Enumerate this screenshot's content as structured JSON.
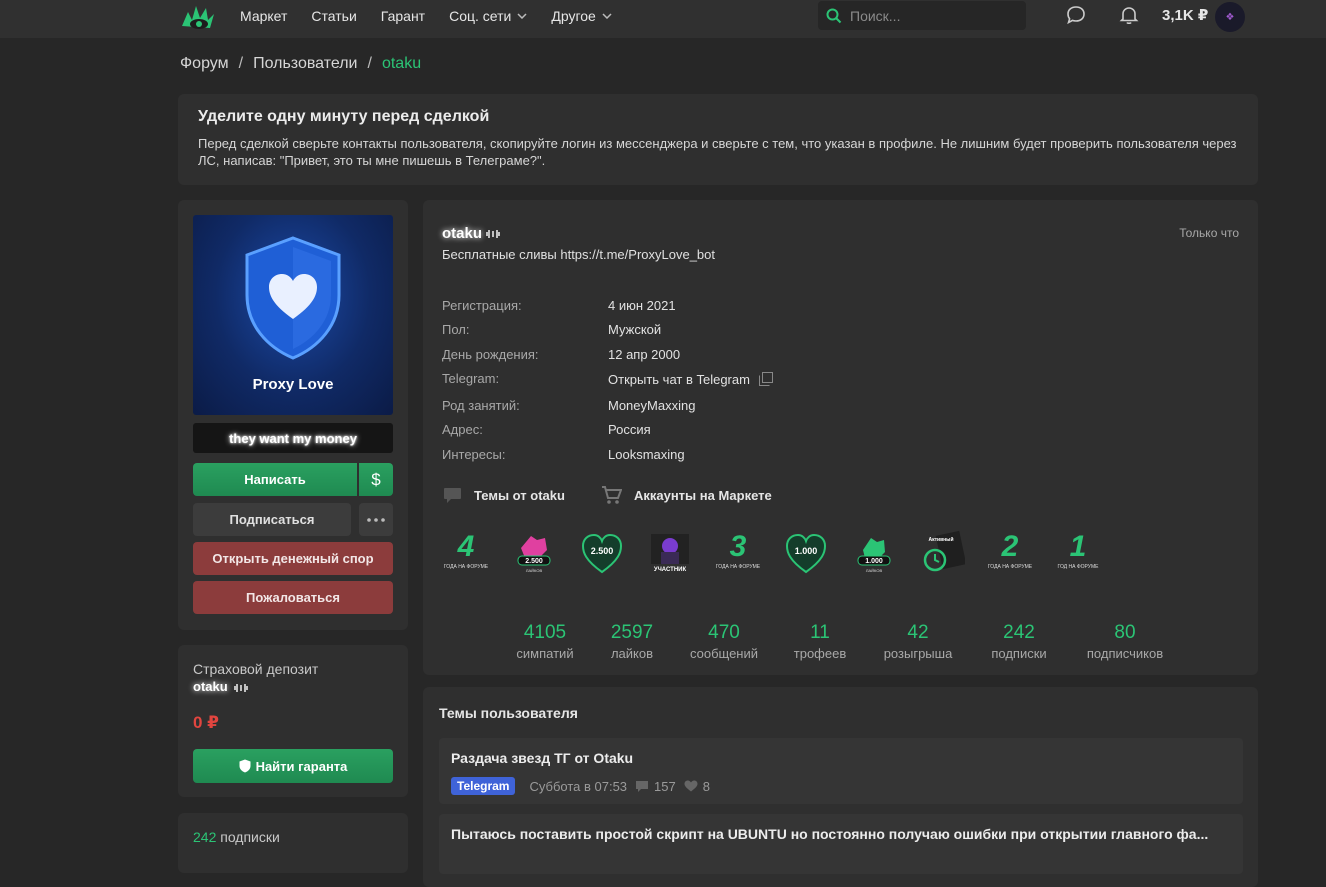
{
  "topbar": {
    "nav": [
      {
        "label": "Маркет",
        "dropdown": false
      },
      {
        "label": "Статьи",
        "dropdown": false
      },
      {
        "label": "Гарант",
        "dropdown": false
      },
      {
        "label": "Соц. сети",
        "dropdown": true
      },
      {
        "label": "Другое",
        "dropdown": true
      }
    ],
    "search_placeholder": "Поиск...",
    "balance": "3,1K ₽"
  },
  "breadcrumb": {
    "items": [
      "Форум",
      "Пользователи"
    ],
    "current": "otaku"
  },
  "notice": {
    "title": "Уделите одну минуту перед сделкой",
    "text": "Перед сделкой сверьте контакты пользователя, скопируйте логин из мессенджера и сверьте с тем, что указан в профиле. Не лишним будет проверить пользователя через ЛС, написав: \"Привет, это ты мне пишешь в Телеграме?\"."
  },
  "sidebar": {
    "avatar_caption": "Proxy Love",
    "user_title": "they want my money",
    "write_button": "Написать",
    "dollar_button": "$",
    "subscribe_button": "Подписаться",
    "dispute_button": "Открыть денежный спор",
    "report_button": "Пожаловаться",
    "deposit_label": "Страховой депозит",
    "deposit_user": "otaku",
    "deposit_amount": "0 ₽",
    "guarantor_button": "Найти гаранта",
    "subs_count": "242",
    "subs_label": "подписки"
  },
  "profile": {
    "username": "otaku",
    "status": "Бесплатные сливы https://t.me/ProxyLove_bot",
    "last_seen": "Только что",
    "info": [
      {
        "key": "Регистрация:",
        "value": "4 июн 2021"
      },
      {
        "key": "Пол:",
        "value": "Мужской"
      },
      {
        "key": "День рождения:",
        "value": "12 апр 2000"
      },
      {
        "key": "Telegram:",
        "value": "Открыть чат в Telegram"
      },
      {
        "key": "Род занятий:",
        "value": "MoneyMaxxing"
      },
      {
        "key": "Адрес:",
        "value": "Россия"
      },
      {
        "key": "Интересы:",
        "value": "Looksmaxing"
      }
    ],
    "links": [
      "Темы от otaku",
      "Аккаунты на Маркете"
    ],
    "trophies": [
      {
        "icon": "years-4-trophy-icon",
        "big": "4",
        "small": "ГОДА НА ФОРУМЕ"
      },
      {
        "icon": "likes-2500-trophy-icon",
        "big": "2.500",
        "small": "ЛАЙКОВ"
      },
      {
        "icon": "sympathies-2500-trophy-icon",
        "big": "2.500",
        "small": ""
      },
      {
        "icon": "participant-trophy-icon",
        "big": "",
        "small": "УЧАСТНИК"
      },
      {
        "icon": "years-3-trophy-icon",
        "big": "3",
        "small": "ГОДА НА ФОРУМЕ"
      },
      {
        "icon": "sympathies-1000-trophy-icon",
        "big": "1.000",
        "small": ""
      },
      {
        "icon": "likes-1000-trophy-icon",
        "big": "1.000",
        "small": "ЛАЙКОВ"
      },
      {
        "icon": "active-trophy-icon",
        "big": "",
        "small": "Активный"
      },
      {
        "icon": "years-2-trophy-icon",
        "big": "2",
        "small": "ГОДА НА ФОРУМЕ"
      },
      {
        "icon": "years-1-trophy-icon",
        "big": "1",
        "small": "ГОД НА ФОРУМЕ"
      }
    ],
    "stats": [
      {
        "num": "4105",
        "label": "симпатий"
      },
      {
        "num": "2597",
        "label": "лайков"
      },
      {
        "num": "470",
        "label": "сообщений"
      },
      {
        "num": "11",
        "label": "трофеев"
      },
      {
        "num": "42",
        "label": "розыгрыша"
      },
      {
        "num": "242",
        "label": "подписки"
      },
      {
        "num": "80",
        "label": "подписчиков"
      }
    ]
  },
  "topics": {
    "title": "Темы пользователя",
    "items": [
      {
        "title": "Раздача звезд ТГ от Otaku",
        "tag": "Telegram",
        "date": "Суббота в 07:53",
        "replies": "157",
        "likes": "8"
      },
      {
        "title": "Пытаюсь поставить простой скрипт на UBUNTU но постоянно получаю ошибки при открытии главного фа..."
      }
    ]
  },
  "colors": {
    "accent": "#2bc475",
    "danger": "#e2453f",
    "tag": "#3f63d8",
    "bg": "#272727",
    "card": "#2f2f2f"
  }
}
